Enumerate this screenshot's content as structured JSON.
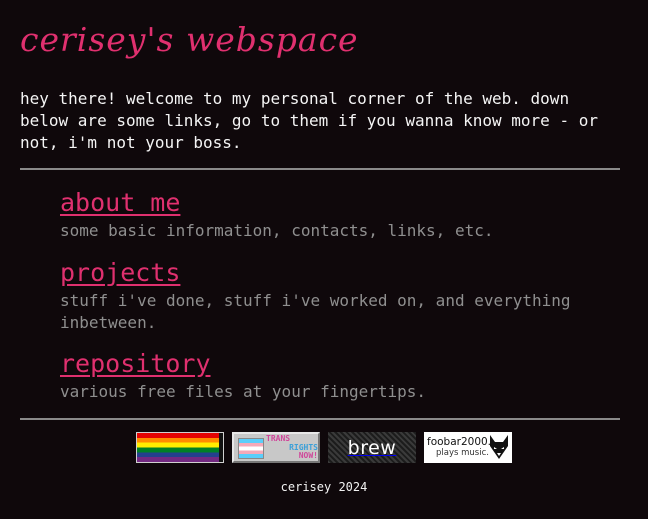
{
  "header": {
    "title": "cerisey's webspace"
  },
  "intro": {
    "text": "hey there! welcome to my personal corner of the web. down below are some links, go to them if you wanna know more - or not, i'm not your boss."
  },
  "nav": {
    "items": [
      {
        "label": "about me",
        "description": "some basic information, contacts, links, etc."
      },
      {
        "label": "projects",
        "description": "stuff i've done, stuff i've worked on, and everything inbetween."
      },
      {
        "label": "repository",
        "description": "various free files at your fingertips."
      }
    ]
  },
  "badges": {
    "pride": {
      "icon": "pride-flag-icon"
    },
    "trans": {
      "line1": "TRANS",
      "line2": "RIGHTS",
      "line3": "NOW!",
      "icon": "trans-flag-icon"
    },
    "brew": {
      "label": "brew"
    },
    "foobar": {
      "name": "foobar2000.",
      "tagline": "plays music.",
      "icon": "foobar-fox-icon"
    }
  },
  "footer": {
    "text": "cerisey 2024"
  },
  "colors": {
    "background": "#0f080b",
    "accent": "#e0306f",
    "muted_text": "#8f8f8f",
    "rule": "#8a8a8a"
  }
}
